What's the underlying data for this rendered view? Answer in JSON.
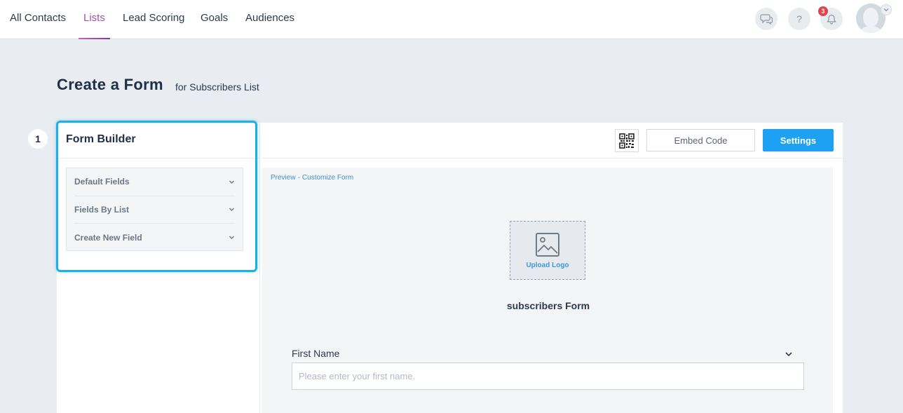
{
  "nav": {
    "tabs": [
      {
        "label": "All Contacts",
        "active": false
      },
      {
        "label": "Lists",
        "active": true
      },
      {
        "label": "Lead Scoring",
        "active": false
      },
      {
        "label": "Goals",
        "active": false
      },
      {
        "label": "Audiences",
        "active": false
      }
    ],
    "help_glyph": "?",
    "notification_count": "3",
    "icons": [
      "chat-icon",
      "help-icon",
      "bell-icon",
      "avatar",
      "chevron-down-icon"
    ]
  },
  "page": {
    "title": "Create a Form",
    "subtitle": "for Subscribers List",
    "step_number": "1"
  },
  "builder": {
    "title": "Form Builder",
    "sections": [
      {
        "label": "Default Fields"
      },
      {
        "label": "Fields By List"
      },
      {
        "label": "Create New Field"
      }
    ]
  },
  "toolbar": {
    "embed_label": "Embed Code",
    "settings_label": "Settings"
  },
  "preview": {
    "crumb_preview": "Preview",
    "crumb_sep": "-",
    "crumb_customize": "Customize Form",
    "upload_logo_label": "Upload Logo",
    "form_name": "subscribers Form",
    "fields": [
      {
        "label": "First Name",
        "placeholder": "Please enter your first name.",
        "value": ""
      }
    ]
  },
  "colors": {
    "accent": "#1da1f2",
    "active_tab": "#a64fb0",
    "highlight": "#1cb0e6",
    "badge": "#e0434d"
  }
}
